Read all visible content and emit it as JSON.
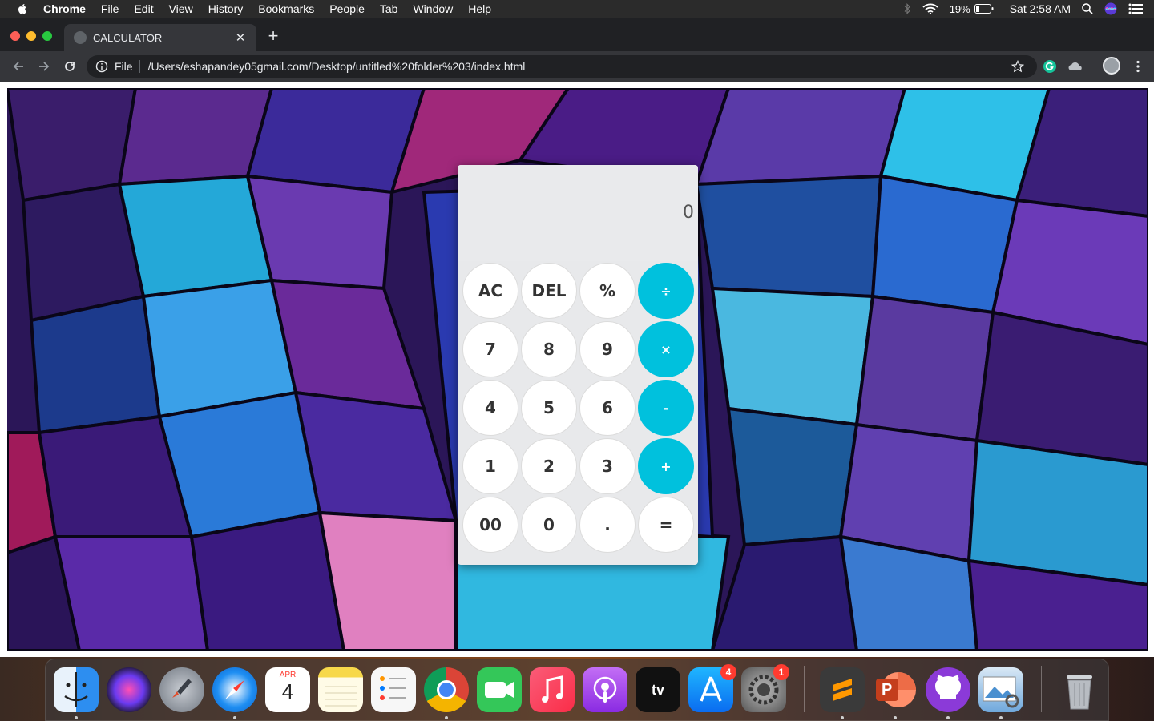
{
  "menubar": {
    "app_name": "Chrome",
    "items": [
      "File",
      "Edit",
      "View",
      "History",
      "Bookmarks",
      "People",
      "Tab",
      "Window",
      "Help"
    ],
    "battery_percent": "19%",
    "clock": "Sat 2:58 AM"
  },
  "browser": {
    "tab_title": "CALCULATOR",
    "new_tab_label": "+",
    "close_tab_label": "✕",
    "scheme_label": "File",
    "url": "/Users/eshapandey05gmail.com/Desktop/untitled%20folder%203/index.html"
  },
  "calculator": {
    "display_value": "0",
    "keys": [
      {
        "label": "AC",
        "type": "function"
      },
      {
        "label": "DEL",
        "type": "function"
      },
      {
        "label": "%",
        "type": "function"
      },
      {
        "label": "÷",
        "type": "operator"
      },
      {
        "label": "7",
        "type": "digit"
      },
      {
        "label": "8",
        "type": "digit"
      },
      {
        "label": "9",
        "type": "digit"
      },
      {
        "label": "×",
        "type": "operator"
      },
      {
        "label": "4",
        "type": "digit"
      },
      {
        "label": "5",
        "type": "digit"
      },
      {
        "label": "6",
        "type": "digit"
      },
      {
        "label": "-",
        "type": "operator"
      },
      {
        "label": "1",
        "type": "digit"
      },
      {
        "label": "2",
        "type": "digit"
      },
      {
        "label": "3",
        "type": "digit"
      },
      {
        "label": "+",
        "type": "operator"
      },
      {
        "label": "00",
        "type": "digit"
      },
      {
        "label": "0",
        "type": "digit"
      },
      {
        "label": ".",
        "type": "digit"
      },
      {
        "label": "=",
        "type": "equals"
      }
    ],
    "colors": {
      "operator": "#00c1dd",
      "key": "#ffffff",
      "body": "#e8e9eb"
    }
  },
  "dock": {
    "apps": [
      {
        "name": "finder-icon",
        "color": "#3aa0f0",
        "running": true
      },
      {
        "name": "siri-icon",
        "color": "#1c1c2e",
        "running": false
      },
      {
        "name": "launchpad-icon",
        "color": "#8e96a3",
        "running": false
      },
      {
        "name": "safari-icon",
        "color": "#1e8ef2",
        "running": true
      },
      {
        "name": "calendar-icon",
        "color": "#ffffff",
        "running": false,
        "month": "APR",
        "day": "4"
      },
      {
        "name": "notes-icon",
        "color": "#f7d84a",
        "running": false
      },
      {
        "name": "reminders-icon",
        "color": "#f4f4f4",
        "running": false
      },
      {
        "name": "chrome-icon",
        "color": "#db4437",
        "running": true
      },
      {
        "name": "facetime-icon",
        "color": "#34c759",
        "running": false
      },
      {
        "name": "music-icon",
        "color": "#fa3c5a",
        "running": false
      },
      {
        "name": "podcasts-icon",
        "color": "#9b3ad8",
        "running": false
      },
      {
        "name": "apple-tv-icon",
        "color": "#111111",
        "running": false,
        "text": "tv"
      },
      {
        "name": "app-store-icon",
        "color": "#1a8cf7",
        "running": false,
        "badge": "4"
      },
      {
        "name": "system-preferences-icon",
        "color": "#8a8a8a",
        "running": false,
        "badge": "1"
      },
      {
        "name": "sublime-text-icon",
        "color": "#3a3a3a",
        "running": true
      },
      {
        "name": "powerpoint-icon",
        "color": "#d24726",
        "running": true,
        "text": "P"
      },
      {
        "name": "github-desktop-icon",
        "color": "#8b3ad8",
        "running": true
      },
      {
        "name": "preview-icon",
        "color": "#6fa8dc",
        "running": true
      },
      {
        "name": "trash-icon",
        "color": "#b8bcc2",
        "running": false
      }
    ]
  }
}
